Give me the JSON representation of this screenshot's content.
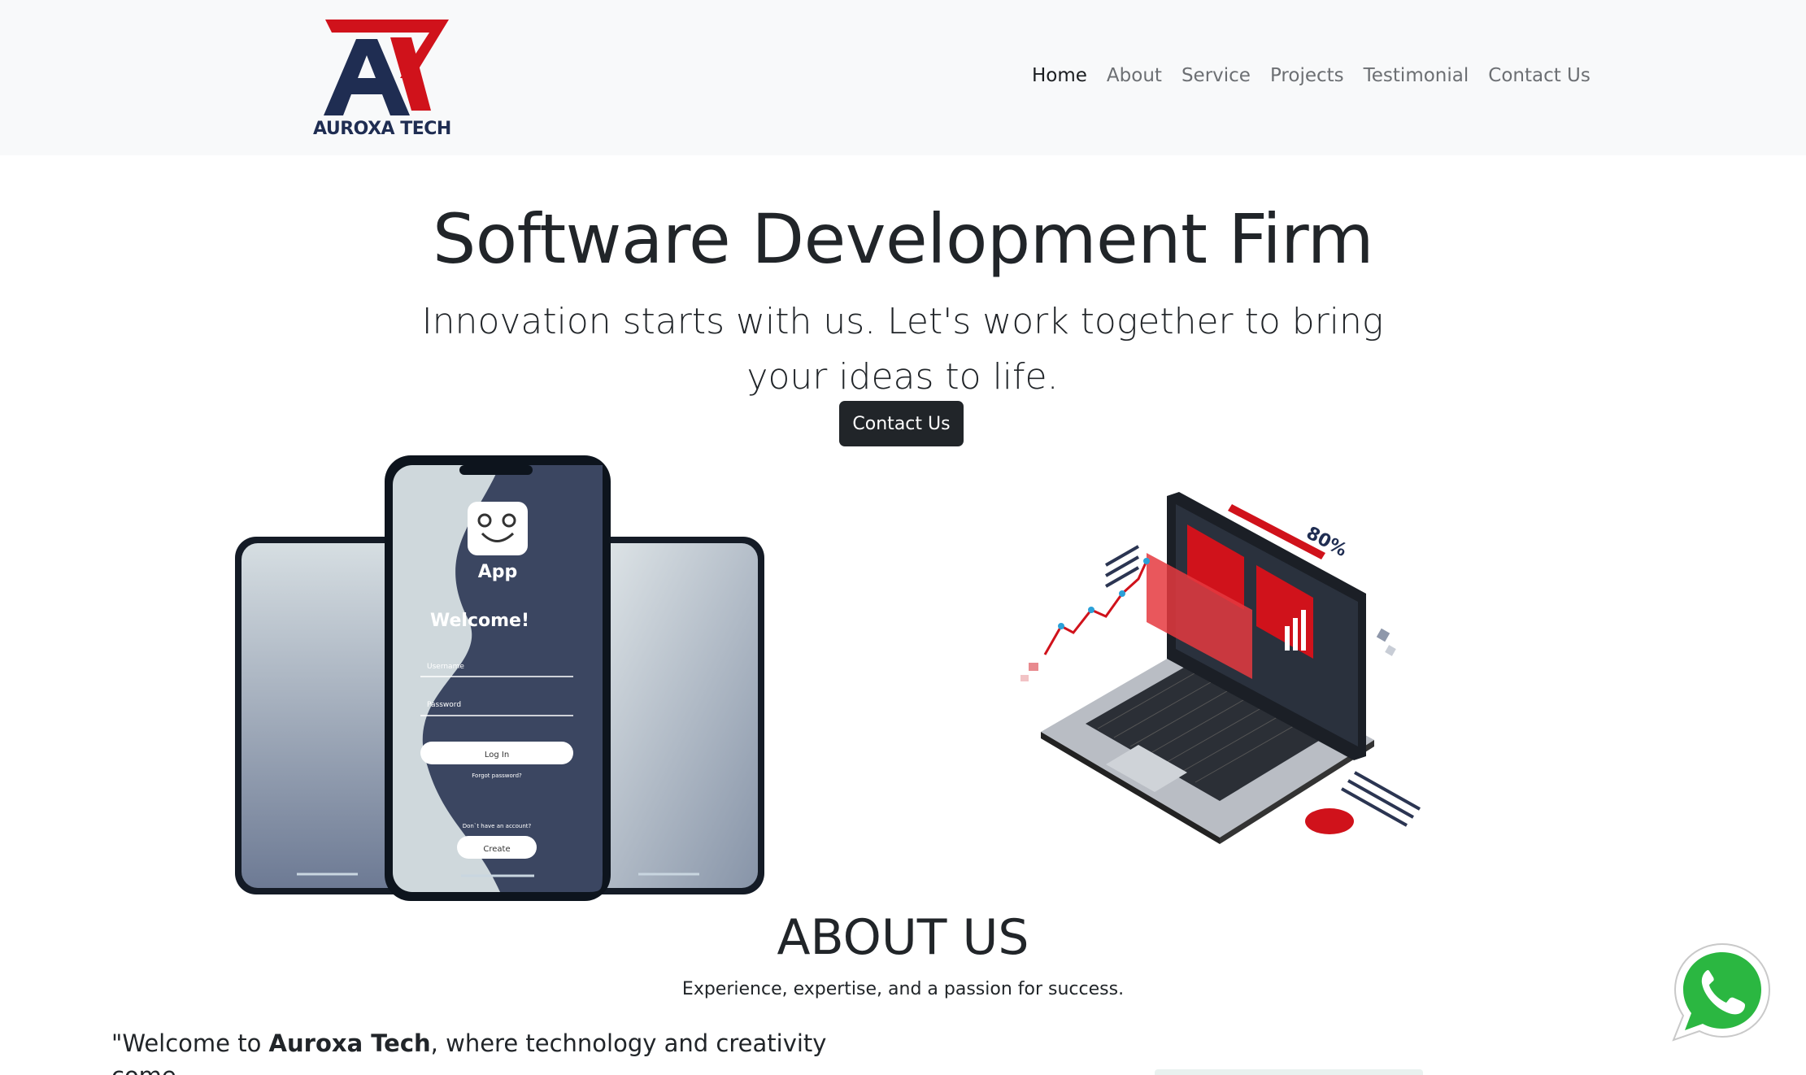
{
  "brand": {
    "name": "AUROXA TECH",
    "colors": {
      "navy": "#1f2d52",
      "red": "#d0121b",
      "dark": "#212529",
      "navbar_bg": "#f8f9fa"
    }
  },
  "nav": {
    "items": [
      {
        "label": "Home",
        "active": true
      },
      {
        "label": "About",
        "active": false
      },
      {
        "label": "Service",
        "active": false
      },
      {
        "label": "Projects",
        "active": false
      },
      {
        "label": "Testimonial",
        "active": false
      },
      {
        "label": "Contact Us",
        "active": false
      }
    ]
  },
  "hero": {
    "title": "Software Development Firm",
    "subtitle": "Innovation starts with us. Let's work together to bring your ideas to life.",
    "cta_label": "Contact Us"
  },
  "phone_mockup": {
    "app_label": "App",
    "welcome": "Welcome!",
    "username_label": "Username",
    "password_label": "Password",
    "login_label": "Log In",
    "forgot_label": "Forgot password?",
    "no_account_label": "Don`t have an account?",
    "create_label": "Create"
  },
  "laptop_illustration": {
    "percent_label": "80%"
  },
  "about": {
    "title": "ABOUT US",
    "subtitle": "Experience, expertise, and a passion for success.",
    "text_prefix": "\"Welcome to ",
    "text_brand": "Auroxa Tech",
    "text_suffix": ", where technology and creativity come"
  },
  "icons": [
    "whatsapp-icon",
    "smiley-app-icon"
  ]
}
